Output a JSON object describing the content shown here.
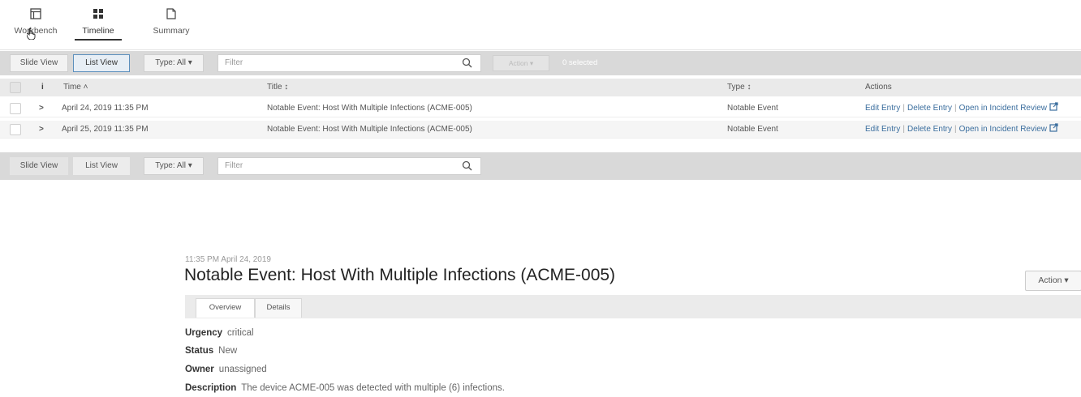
{
  "nav": {
    "tabs": [
      {
        "label": "Workbench",
        "icon": "workbench-icon"
      },
      {
        "label": "Timeline",
        "icon": "grid-icon"
      },
      {
        "label": "Summary",
        "icon": "document-icon"
      }
    ]
  },
  "toolbar1": {
    "slide_view": "Slide View",
    "list_view": "List View",
    "type": "Type: All ▾",
    "filter_placeholder": "Filter",
    "action": "Action ▾",
    "selected": "0 selected"
  },
  "table": {
    "headers": {
      "info": "i",
      "time": "Time ˄",
      "title": "Title ↕",
      "type": "Type ↕",
      "actions": "Actions"
    },
    "rows": [
      {
        "time": "April 24, 2019 11:35 PM",
        "title": "Notable Event: Host With Multiple Infections (ACME-005)",
        "type": "Notable Event"
      },
      {
        "time": "April 25, 2019 11:35 PM",
        "title": "Notable Event: Host With Multiple Infections (ACME-005)",
        "type": "Notable Event"
      }
    ],
    "row_links": {
      "edit": "Edit Entry",
      "delete": "Delete Entry",
      "open": "Open in Incident Review",
      "separator": "|"
    }
  },
  "toolbar2": {
    "slide_view": "Slide View",
    "list_view": "List View",
    "type": "Type: All ▾",
    "filter_placeholder": "Filter"
  },
  "detail": {
    "date": "11:35 PM April 24, 2019",
    "title": "Notable Event: Host With Multiple Infections (ACME-005)",
    "action": "Action ▾",
    "tabs": [
      "Overview",
      "Details"
    ],
    "fields": [
      {
        "label": "Urgency",
        "value": "critical"
      },
      {
        "label": "Status",
        "value": "New"
      },
      {
        "label": "Owner",
        "value": "unassigned"
      },
      {
        "label": "Description",
        "value": "The device ACME-005 was detected with multiple (6) infections."
      }
    ]
  },
  "colors": {
    "link": "#3b6e9e",
    "toolbar": "#d9d9d9",
    "active_border": "#5b8fbd"
  }
}
